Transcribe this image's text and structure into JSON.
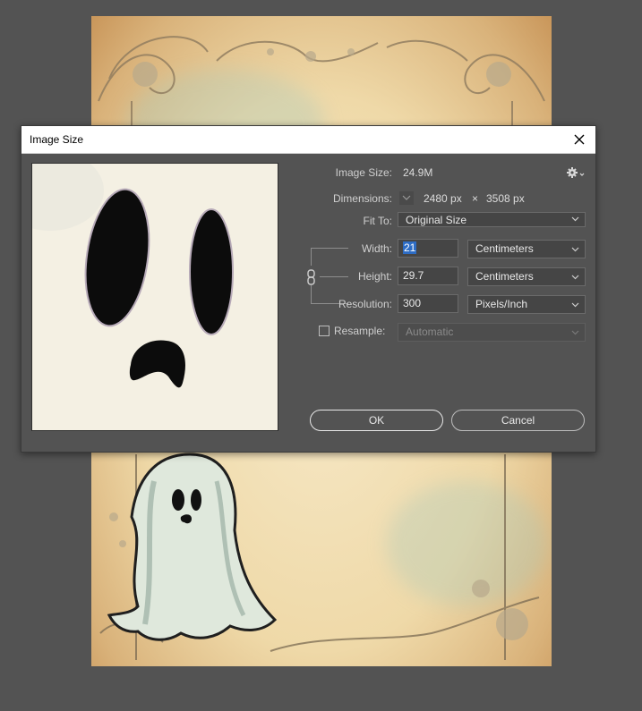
{
  "dialog": {
    "title": "Image Size",
    "image_size_label": "Image Size:",
    "image_size_value": "24.9M",
    "dimensions_label": "Dimensions:",
    "dimensions_width": "2480 px",
    "dimensions_times": "×",
    "dimensions_height": "3508 px",
    "fit_to_label": "Fit To:",
    "fit_to_value": "Original Size",
    "width_label": "Width:",
    "width_value": "21",
    "width_unit": "Centimeters",
    "height_label": "Height:",
    "height_value": "29.7",
    "height_unit": "Centimeters",
    "resolution_label": "Resolution:",
    "resolution_value": "300",
    "resolution_unit": "Pixels/Inch",
    "resample_label": "Resample:",
    "resample_value": "Automatic",
    "ok_label": "OK",
    "cancel_label": "Cancel"
  },
  "icons": {
    "close": "close-icon",
    "settings": "gear-icon",
    "dimensions_dropdown": "chevron-down-icon",
    "link": "chain-link-icon"
  },
  "colors": {
    "dialog_bg": "#535353",
    "titlebar_bg": "#ffffff",
    "selection": "#2d6cc4",
    "field_bg": "#454545"
  }
}
